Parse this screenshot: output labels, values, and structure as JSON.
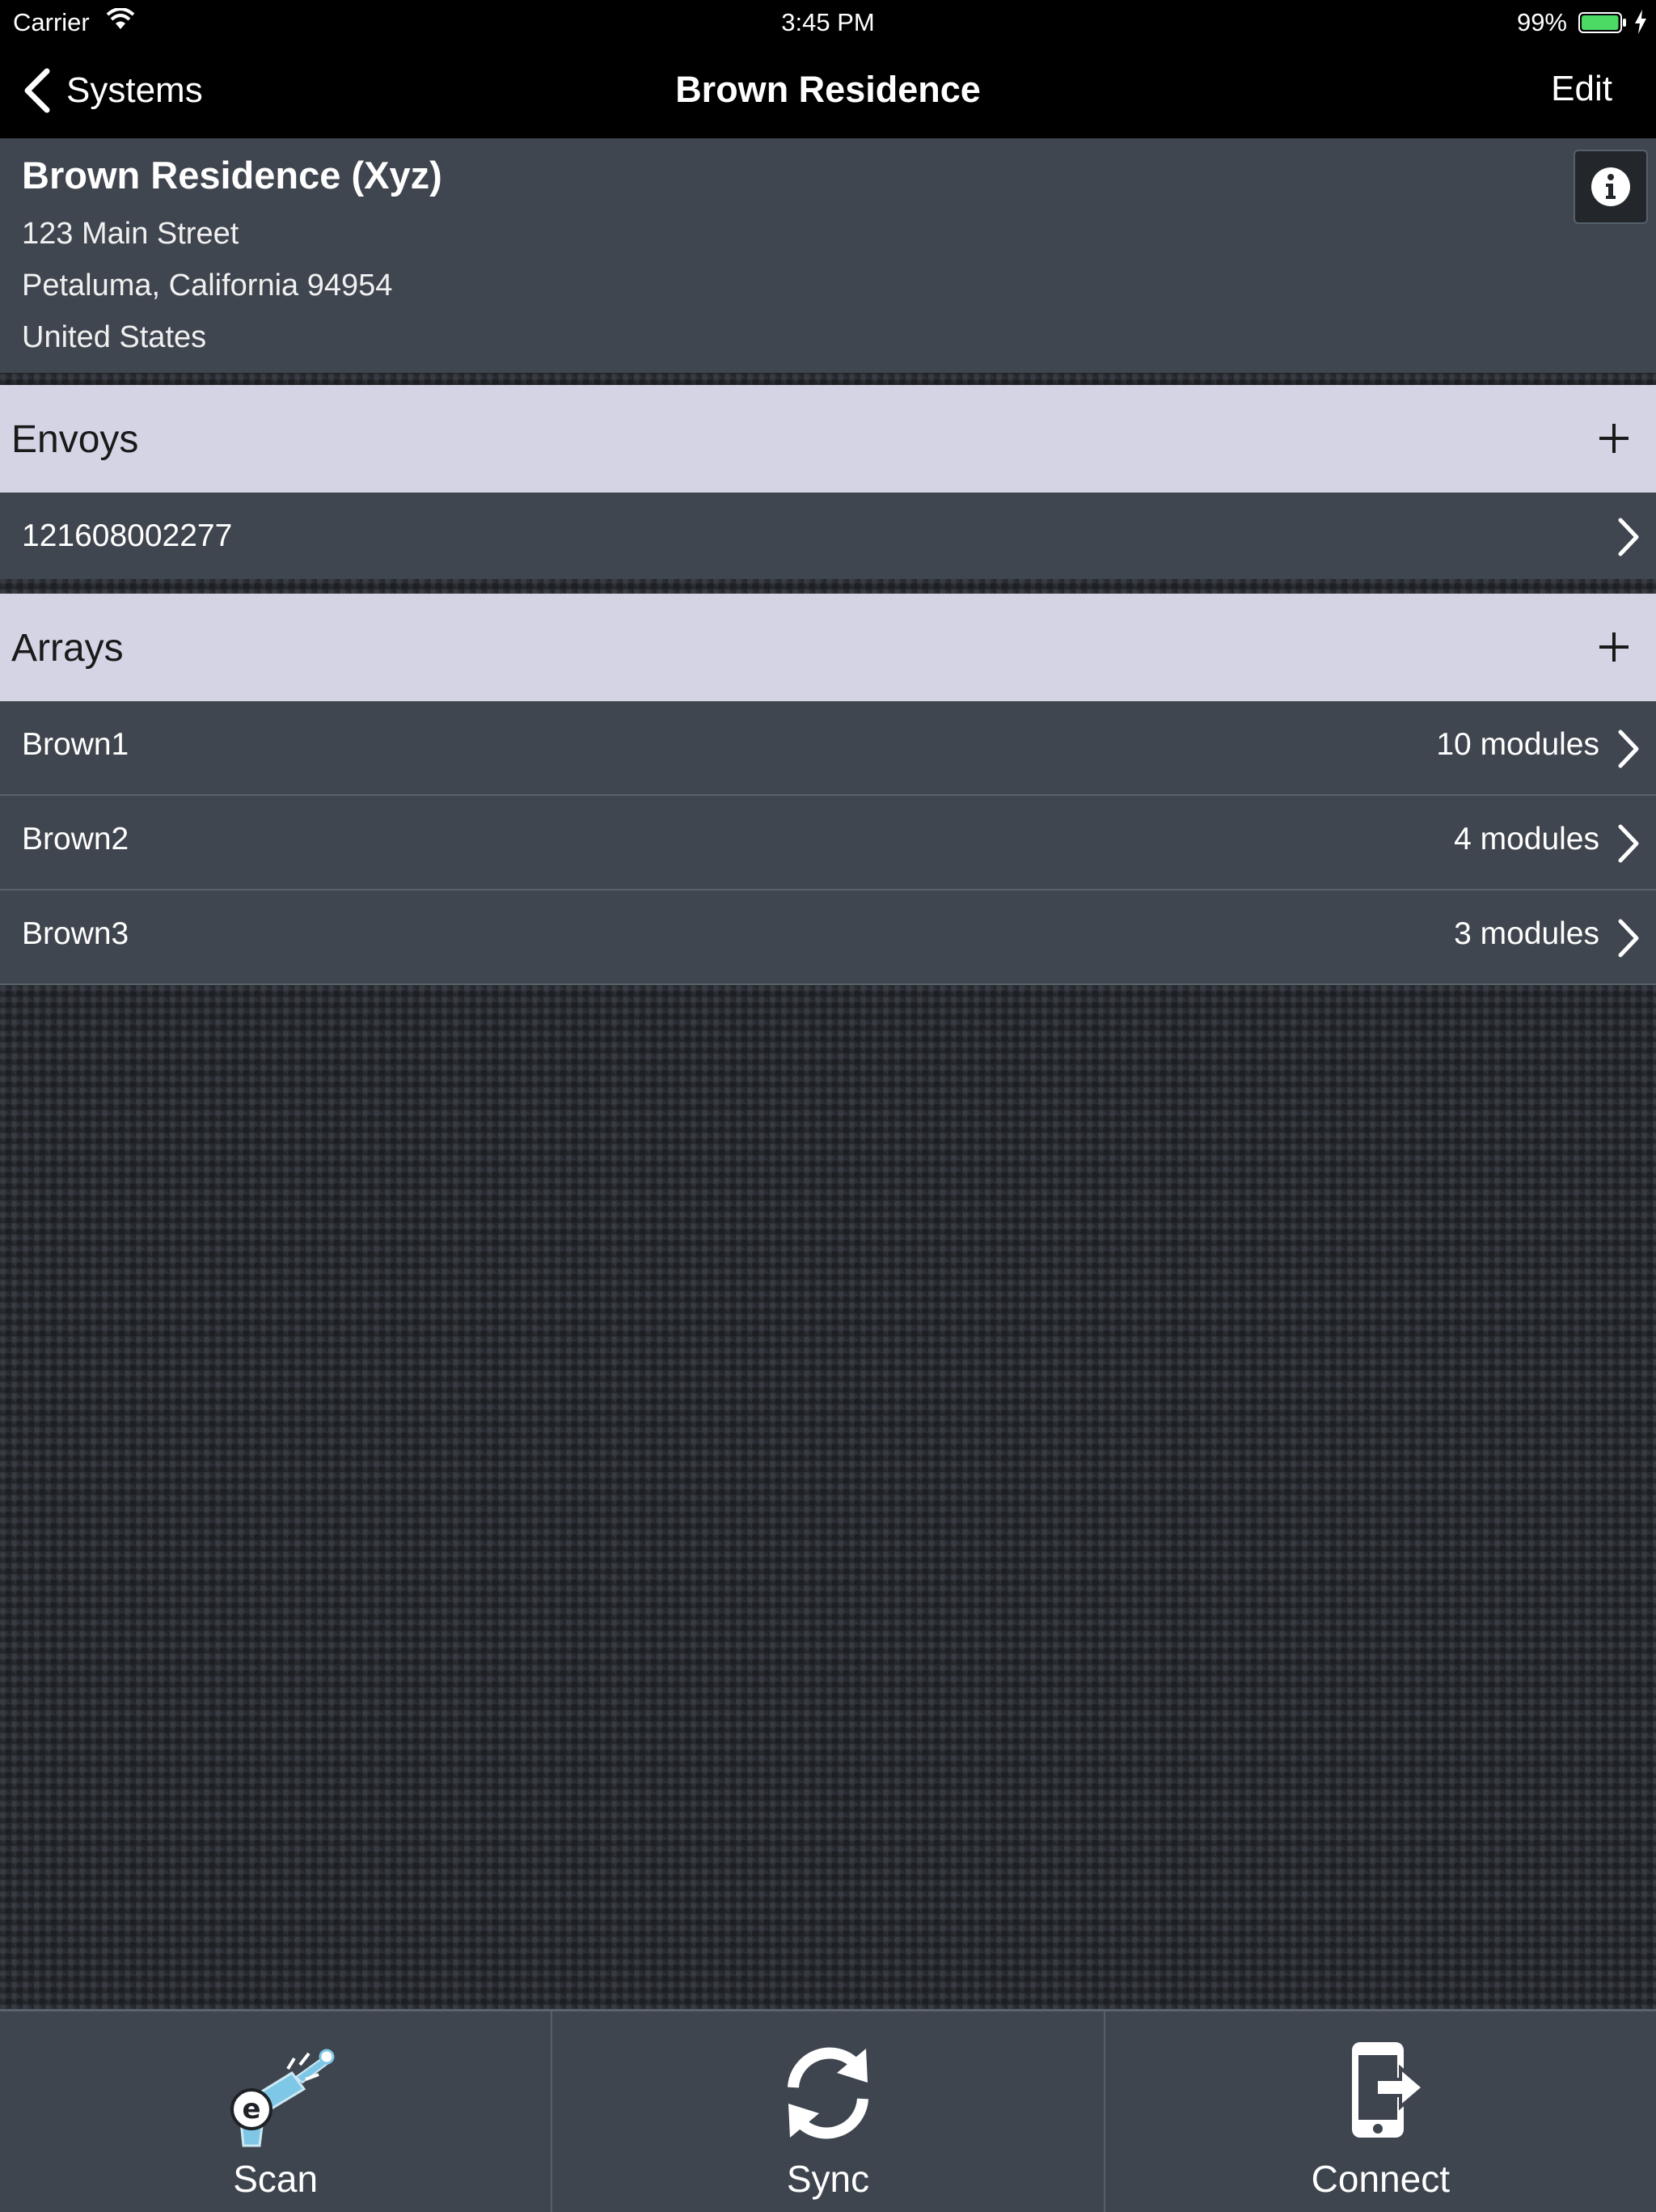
{
  "status_bar": {
    "carrier": "Carrier",
    "time": "3:45 PM",
    "battery": "99%",
    "battery_level": 0.99,
    "icons": [
      "wifi-icon",
      "battery-icon",
      "charging-bolt-icon"
    ]
  },
  "nav": {
    "back_label": "Systems",
    "title": "Brown Residence",
    "edit_label": "Edit",
    "back_icon": "chevron-left-icon"
  },
  "site": {
    "name": "Brown Residence (Xyz)",
    "address_line1": "123 Main Street",
    "address_line2": "Petaluma, California 94954",
    "address_line3": "United States",
    "info_icon": "info-icon"
  },
  "envoys": {
    "header": "Envoys",
    "add_icon": "plus-icon",
    "items": [
      {
        "label": "121608002277"
      }
    ]
  },
  "arrays": {
    "header": "Arrays",
    "add_icon": "plus-icon",
    "items": [
      {
        "label": "Brown1",
        "value": "10 modules"
      },
      {
        "label": "Brown2",
        "value": "4 modules"
      },
      {
        "label": "Brown3",
        "value": "3 modules"
      }
    ]
  },
  "tabs": [
    {
      "label": "Scan",
      "icon": "scan-gun-icon"
    },
    {
      "label": "Sync",
      "icon": "sync-icon"
    },
    {
      "label": "Connect",
      "icon": "connect-phone-icon"
    }
  ],
  "colors": {
    "nav_background": "#000000",
    "panel": "#40464f",
    "section_header": "#d4d4e5",
    "battery_green": "#4cd964",
    "scan_accent": "#7fc7e6"
  }
}
